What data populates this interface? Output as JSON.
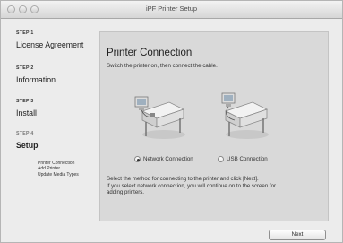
{
  "window": {
    "title": "iPF Printer Setup"
  },
  "steps": [
    {
      "num": "STEP 1",
      "title": "License Agreement"
    },
    {
      "num": "STEP 2",
      "title": "Information"
    },
    {
      "num": "STEP 3",
      "title": "Install"
    },
    {
      "num": "STEP 4",
      "title": "Setup"
    }
  ],
  "substeps": [
    "Printer Connection",
    "Add Printer",
    "Update Media Types"
  ],
  "panel": {
    "title": "Printer Connection",
    "subtitle": "Switch the printer on, then connect the cable.",
    "options": [
      {
        "label": "Network Connection",
        "selected": true
      },
      {
        "label": "USB Connection",
        "selected": false
      }
    ],
    "description_line1": "Select the method for connecting to the printer and click [Next].",
    "description_line2": "If you select network connection, you will continue on to the screen for",
    "description_line3": "adding printers."
  },
  "buttons": {
    "next": "Next"
  }
}
